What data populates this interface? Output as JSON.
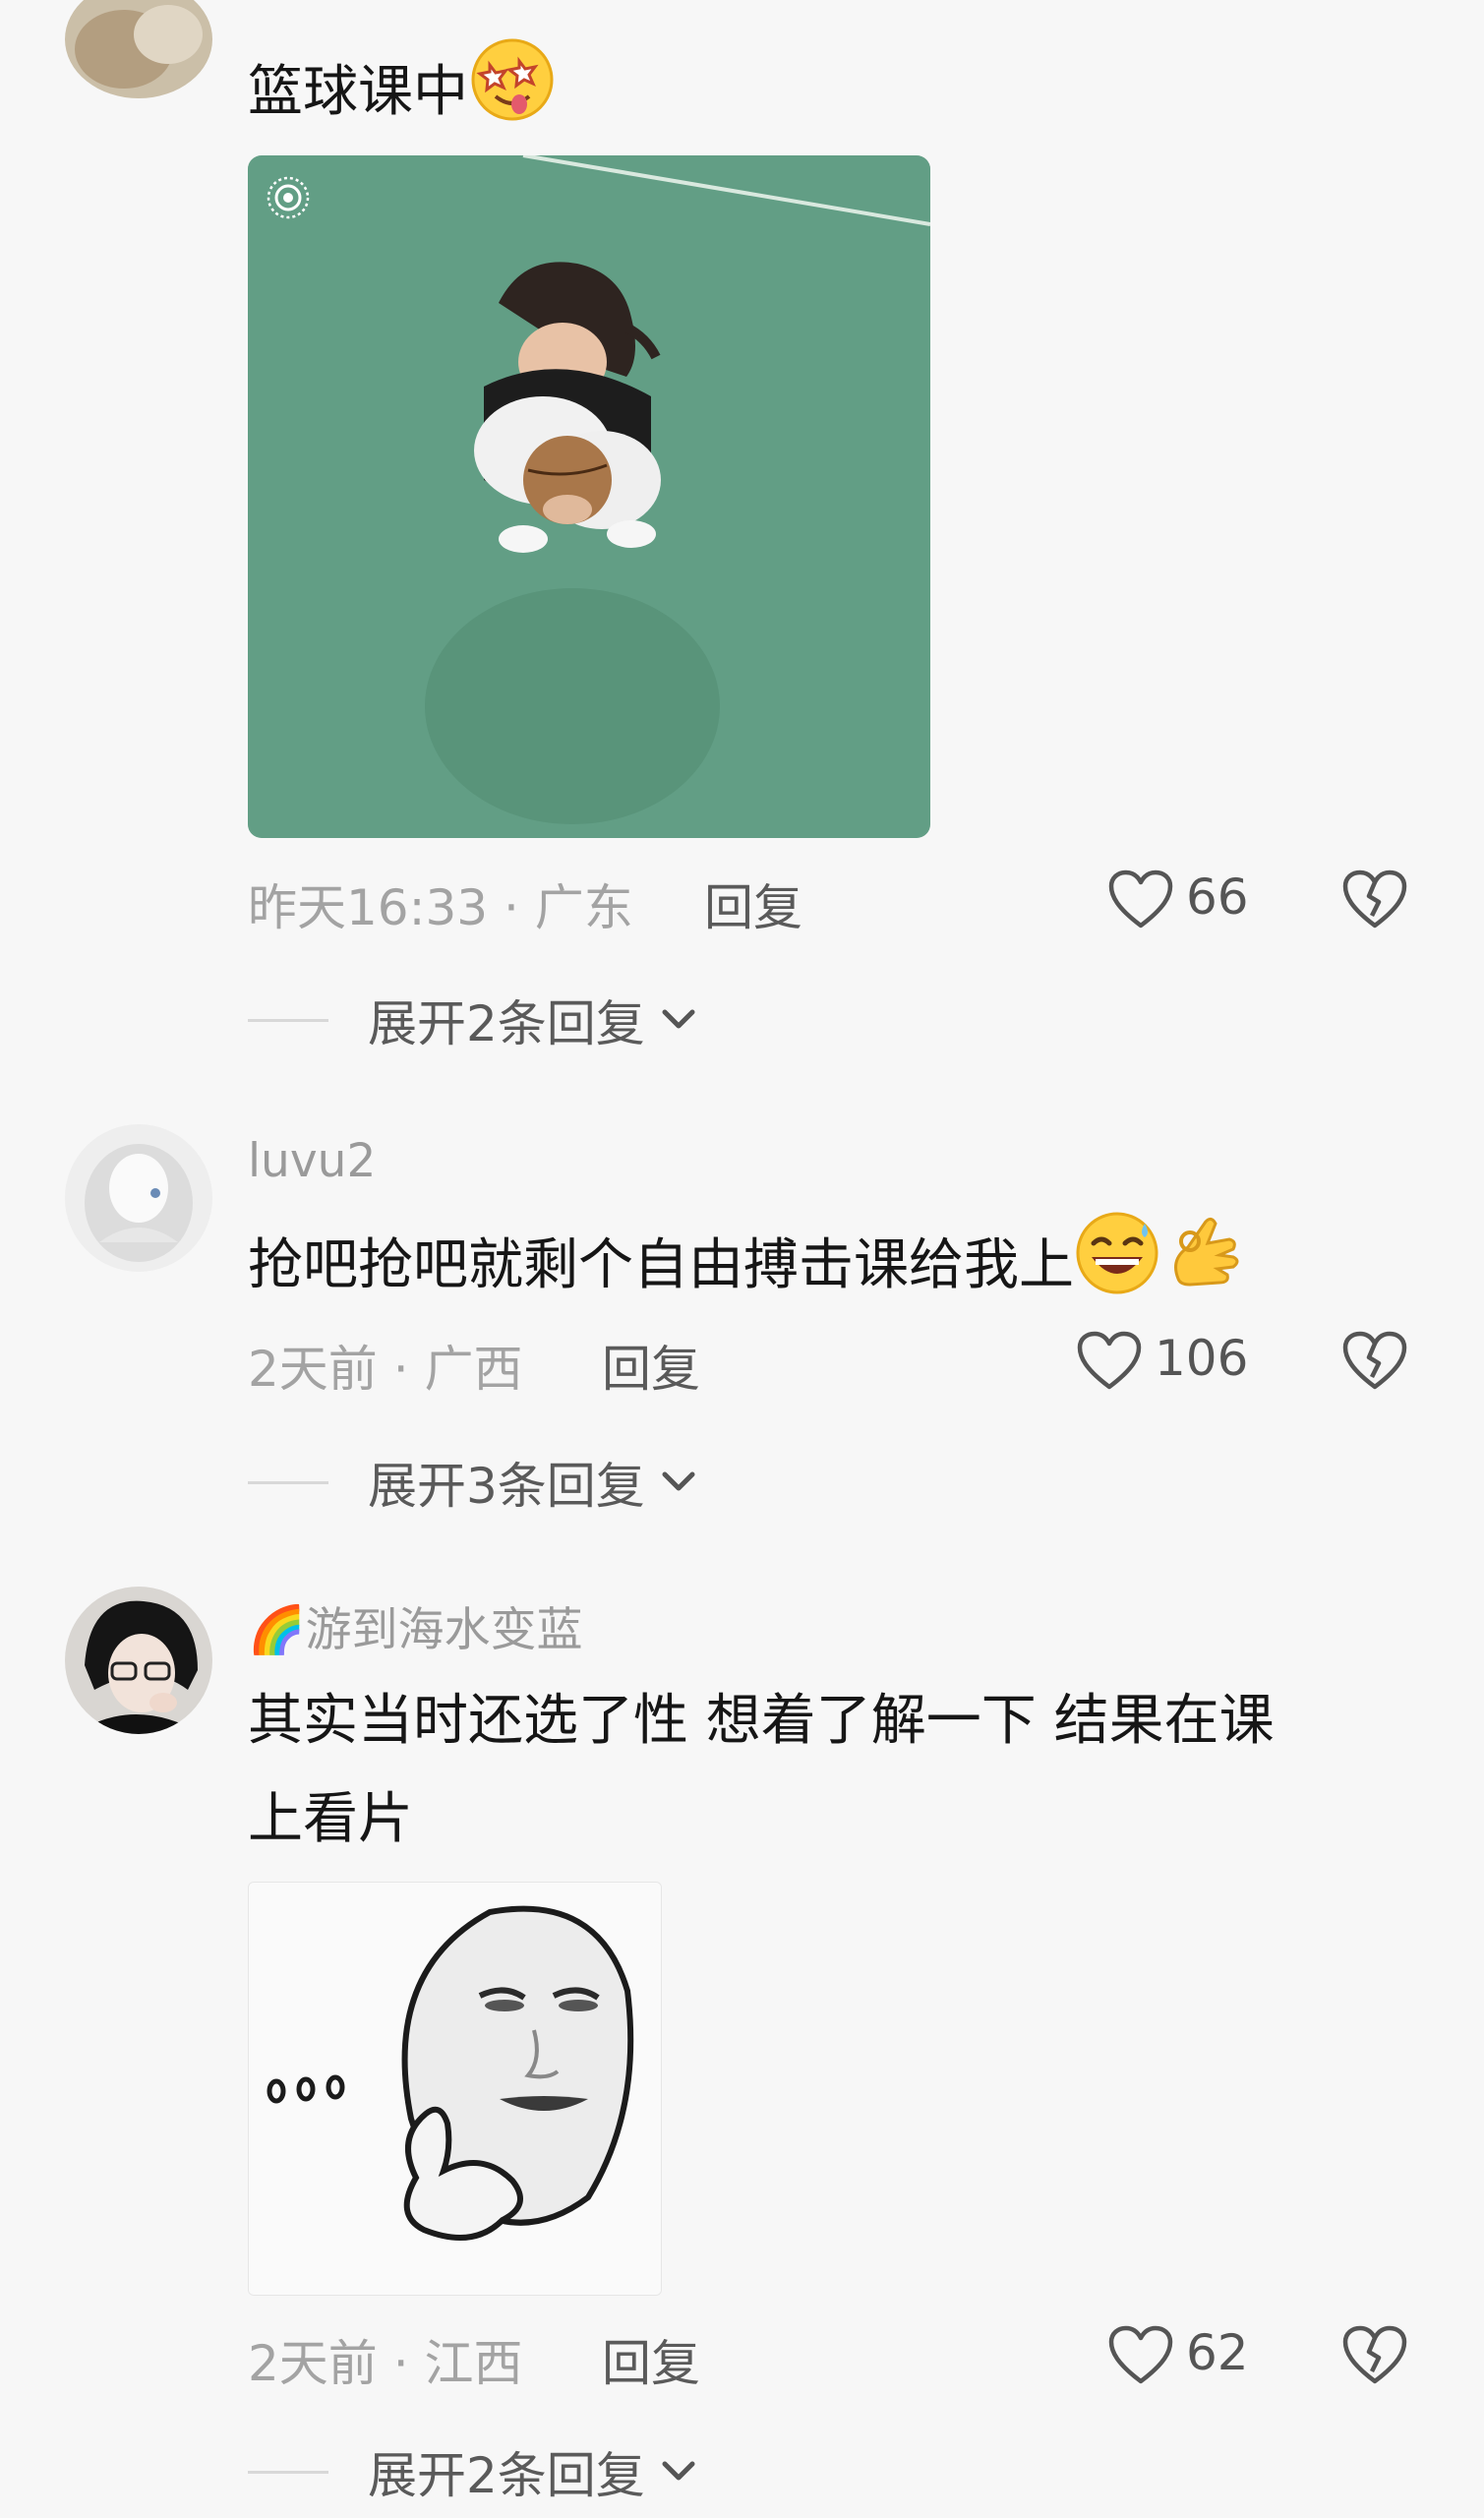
{
  "comments": [
    {
      "username": "",
      "text": "篮球课中",
      "emoji": [
        "drooling-starry-eyes-emoji"
      ],
      "image": "photo-girl-with-basketball",
      "time_location": "昨天16:33 · 广东",
      "reply_label": "回复",
      "likes": "66",
      "expand_label": "展开2条回复"
    },
    {
      "username": "luvu2",
      "text": "抢吧抢吧就剩个自由搏击课给我上",
      "emoji": [
        "grinning-sweat-emoji",
        "ok-hand-emoji"
      ],
      "time_location": "2天前 · 广西",
      "reply_label": "回复",
      "likes": "106",
      "expand_label": "展开3条回复"
    },
    {
      "username_badge": "🌈",
      "username": "游到海水变蓝",
      "text_line1": "其实当时还选了性 想着了解一下 结果在课",
      "text_line2": "上看片",
      "image": "meme-face-sticker",
      "sticker_text": "o o o",
      "time_location": "2天前 · 江西",
      "reply_label": "回复",
      "likes": "62",
      "expand_label": "展开2条回复"
    }
  ],
  "icons": {
    "like": "heart-outline-icon",
    "dislike": "broken-heart-icon",
    "expand": "chevron-down-icon",
    "live_photo": "live-photo-icon"
  },
  "colors": {
    "background": "#f7f7f7",
    "court_green": "#5e9a80",
    "meta_gray": "#a3a3a3"
  }
}
